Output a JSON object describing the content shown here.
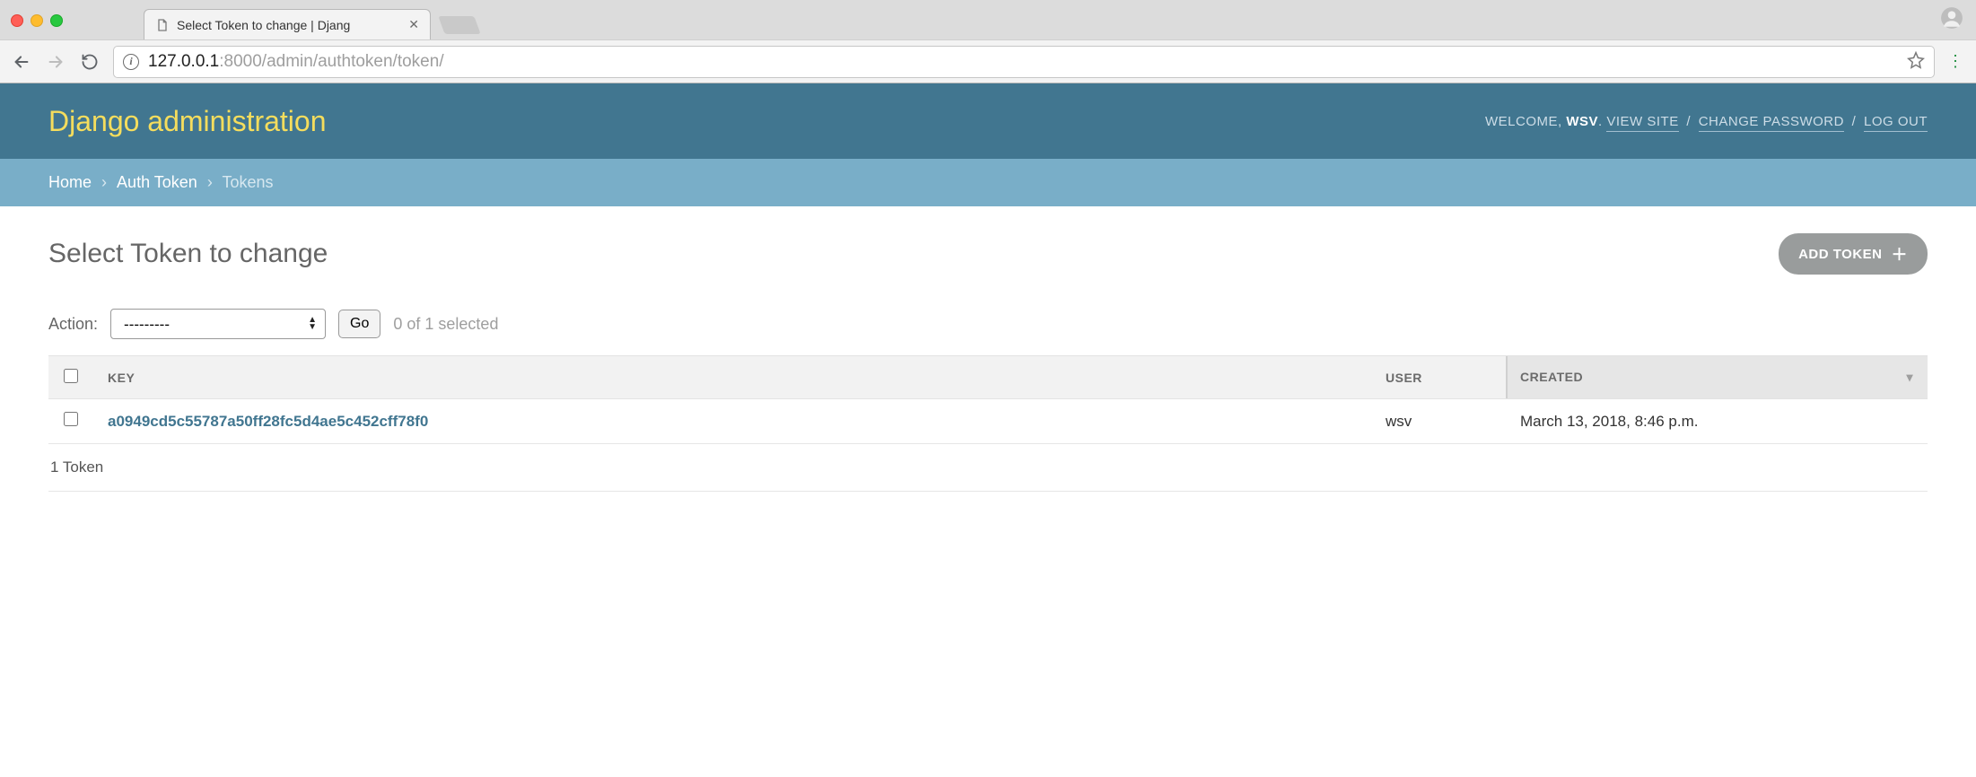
{
  "browser": {
    "tab_title": "Select Token to change | Djang",
    "url_host_strong": "127.0.0.1",
    "url_rest": ":8000/admin/authtoken/token/"
  },
  "header": {
    "brand": "Django administration",
    "welcome_prefix": "WELCOME, ",
    "username": "WSV",
    "view_site": "VIEW SITE",
    "change_password": "CHANGE PASSWORD",
    "logout": "LOG OUT",
    "sep": " / "
  },
  "breadcrumbs": {
    "home": "Home",
    "app": "Auth Token",
    "current": "Tokens",
    "sep": "›"
  },
  "page": {
    "title": "Select Token to change",
    "add_label": "ADD TOKEN"
  },
  "actions": {
    "label": "Action:",
    "placeholder_option": "---------",
    "go": "Go",
    "selection_count": "0 of 1 selected"
  },
  "table": {
    "headers": {
      "key": "KEY",
      "user": "USER",
      "created": "CREATED"
    },
    "rows": [
      {
        "key": "a0949cd5c55787a50ff28fc5d4ae5c452cff78f0",
        "user": "wsv",
        "created": "March 13, 2018, 8:46 p.m."
      }
    ]
  },
  "paginator": {
    "summary": "1 Token"
  }
}
